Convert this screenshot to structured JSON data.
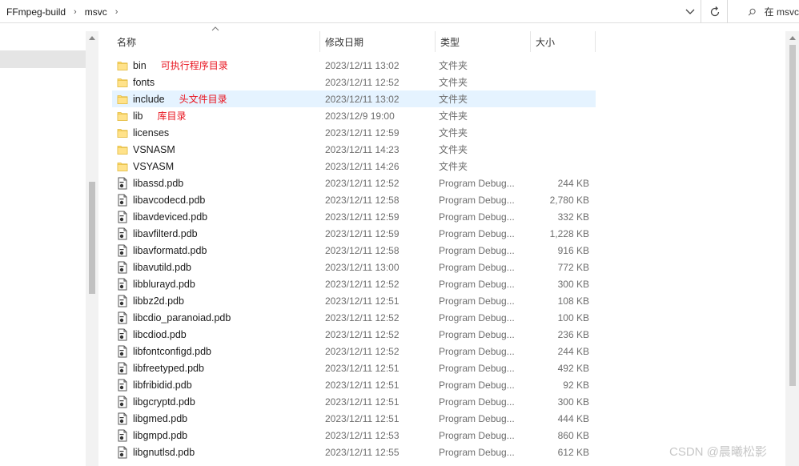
{
  "address": {
    "crumbs": [
      "FFmpeg-build",
      "msvc"
    ],
    "separator": "›",
    "search_placeholder": "在 msvc"
  },
  "columns": {
    "name": "名称",
    "date": "修改日期",
    "type": "类型",
    "size": "大小"
  },
  "icons": {
    "folder": "folder-icon",
    "pdb": "pdb-file-icon",
    "refresh": "refresh-icon",
    "search": "search-icon",
    "dropdown": "chevron-down-icon"
  },
  "colors": {
    "annotation": "#e8131e",
    "selected_row": "#e5f3ff",
    "folder": "#ffd866"
  },
  "files": [
    {
      "name": "bin",
      "date": "2023/12/11 13:02",
      "type": "文件夹",
      "size": "",
      "kind": "folder",
      "note": "可执行程序目录"
    },
    {
      "name": "fonts",
      "date": "2023/12/11 12:52",
      "type": "文件夹",
      "size": "",
      "kind": "folder",
      "note": ""
    },
    {
      "name": "include",
      "date": "2023/12/11 13:02",
      "type": "文件夹",
      "size": "",
      "kind": "folder",
      "note": "头文件目录",
      "selected": true
    },
    {
      "name": "lib",
      "date": "2023/12/9 19:00",
      "type": "文件夹",
      "size": "",
      "kind": "folder",
      "note": "库目录"
    },
    {
      "name": "licenses",
      "date": "2023/12/11 12:59",
      "type": "文件夹",
      "size": "",
      "kind": "folder",
      "note": ""
    },
    {
      "name": "VSNASM",
      "date": "2023/12/11 14:23",
      "type": "文件夹",
      "size": "",
      "kind": "folder",
      "note": ""
    },
    {
      "name": "VSYASM",
      "date": "2023/12/11 14:26",
      "type": "文件夹",
      "size": "",
      "kind": "folder",
      "note": ""
    },
    {
      "name": "libassd.pdb",
      "date": "2023/12/11 12:52",
      "type": "Program Debug...",
      "size": "244 KB",
      "kind": "pdb",
      "note": ""
    },
    {
      "name": "libavcodecd.pdb",
      "date": "2023/12/11 12:58",
      "type": "Program Debug...",
      "size": "2,780 KB",
      "kind": "pdb",
      "note": ""
    },
    {
      "name": "libavdeviced.pdb",
      "date": "2023/12/11 12:59",
      "type": "Program Debug...",
      "size": "332 KB",
      "kind": "pdb",
      "note": ""
    },
    {
      "name": "libavfilterd.pdb",
      "date": "2023/12/11 12:59",
      "type": "Program Debug...",
      "size": "1,228 KB",
      "kind": "pdb",
      "note": ""
    },
    {
      "name": "libavformatd.pdb",
      "date": "2023/12/11 12:58",
      "type": "Program Debug...",
      "size": "916 KB",
      "kind": "pdb",
      "note": ""
    },
    {
      "name": "libavutild.pdb",
      "date": "2023/12/11 13:00",
      "type": "Program Debug...",
      "size": "772 KB",
      "kind": "pdb",
      "note": ""
    },
    {
      "name": "libblurayd.pdb",
      "date": "2023/12/11 12:52",
      "type": "Program Debug...",
      "size": "300 KB",
      "kind": "pdb",
      "note": ""
    },
    {
      "name": "libbz2d.pdb",
      "date": "2023/12/11 12:51",
      "type": "Program Debug...",
      "size": "108 KB",
      "kind": "pdb",
      "note": ""
    },
    {
      "name": "libcdio_paranoiad.pdb",
      "date": "2023/12/11 12:52",
      "type": "Program Debug...",
      "size": "100 KB",
      "kind": "pdb",
      "note": ""
    },
    {
      "name": "libcdiod.pdb",
      "date": "2023/12/11 12:52",
      "type": "Program Debug...",
      "size": "236 KB",
      "kind": "pdb",
      "note": ""
    },
    {
      "name": "libfontconfigd.pdb",
      "date": "2023/12/11 12:52",
      "type": "Program Debug...",
      "size": "244 KB",
      "kind": "pdb",
      "note": ""
    },
    {
      "name": "libfreetyped.pdb",
      "date": "2023/12/11 12:51",
      "type": "Program Debug...",
      "size": "492 KB",
      "kind": "pdb",
      "note": ""
    },
    {
      "name": "libfribidid.pdb",
      "date": "2023/12/11 12:51",
      "type": "Program Debug...",
      "size": "92 KB",
      "kind": "pdb",
      "note": ""
    },
    {
      "name": "libgcryptd.pdb",
      "date": "2023/12/11 12:51",
      "type": "Program Debug...",
      "size": "300 KB",
      "kind": "pdb",
      "note": ""
    },
    {
      "name": "libgmed.pdb",
      "date": "2023/12/11 12:51",
      "type": "Program Debug...",
      "size": "444 KB",
      "kind": "pdb",
      "note": ""
    },
    {
      "name": "libgmpd.pdb",
      "date": "2023/12/11 12:53",
      "type": "Program Debug...",
      "size": "860 KB",
      "kind": "pdb",
      "note": ""
    },
    {
      "name": "libgnutlsd.pdb",
      "date": "2023/12/11 12:55",
      "type": "Program Debug...",
      "size": "612 KB",
      "kind": "pdb",
      "note": ""
    }
  ],
  "watermark": "CSDN @晨曦松影"
}
